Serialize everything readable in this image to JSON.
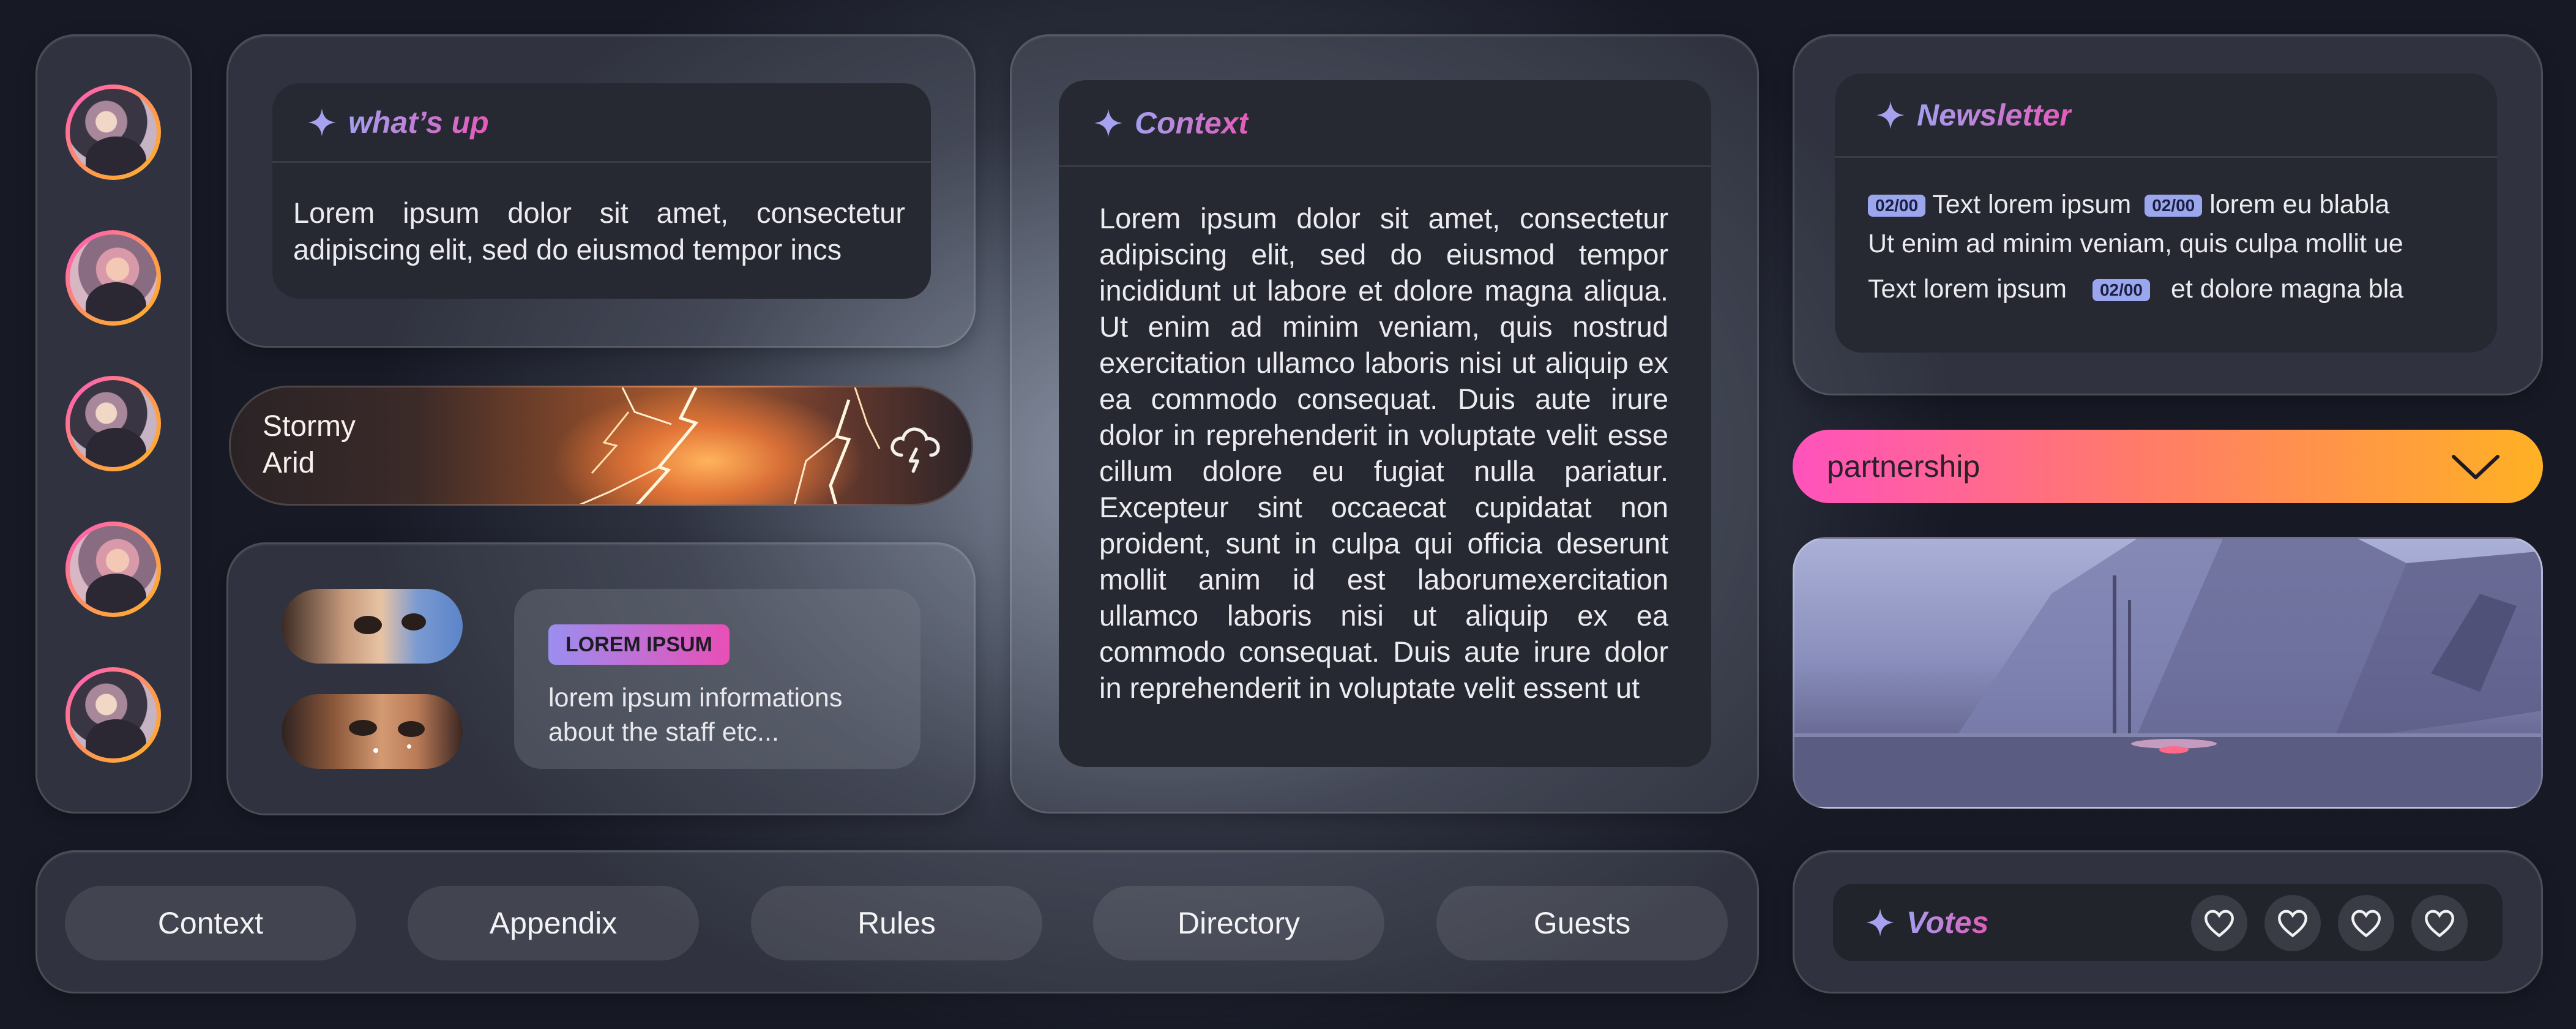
{
  "whatsup": {
    "title": "what’s up",
    "body": "Lorem ipsum dolor sit amet, consectetur adipiscing elit, sed do eiusmod tempor incs"
  },
  "weather": {
    "line1": "Stormy",
    "line2": "Arid",
    "icon": "thunderstorm-cloud-icon"
  },
  "staff": {
    "badge": "LOREM IPSUM",
    "desc": "lorem ipsum informations about the staff etc..."
  },
  "context": {
    "title": "Context",
    "body": "Lorem ipsum dolor sit amet, consectetur adipiscing elit, sed do eiusmod tempor incididunt ut labore et dolore magna aliqua. Ut enim ad minim veniam, quis nostrud exercitation ullamco laboris nisi ut aliquip ex ea commodo consequat. Duis aute irure dolor in reprehenderit in voluptate velit esse cillum dolore eu fugiat nulla pariatur. Excepteur sint occaecat cupidatat non proident, sunt in culpa qui officia deserunt mollit anim id est laborumexercitation ullamco laboris nisi ut aliquip ex ea commodo consequat. Duis aute irure dolor in reprehenderit in voluptate velit essent ut"
  },
  "newsletter": {
    "title": "Newsletter",
    "tag": "02/00",
    "line1_a": "Text lorem ipsum",
    "line1_b": "lorem eu blabla",
    "line2": "Ut enim ad minim veniam, quis culpa mollit ue",
    "line3_a": "Text lorem ipsum",
    "line3_b": "et dolore magna bla"
  },
  "dropdown": {
    "selected": "partnership"
  },
  "nav": {
    "items": [
      "Context",
      "Appendix",
      "Rules",
      "Directory",
      "Guests"
    ]
  },
  "votes": {
    "title": "Votes",
    "count": 4
  },
  "colors": {
    "accent_start": "#a39ff0",
    "accent_end": "#e35bb9",
    "dropdown_start": "#ff52bd",
    "dropdown_end": "#ffb124",
    "tag": "#9aa7ef"
  }
}
